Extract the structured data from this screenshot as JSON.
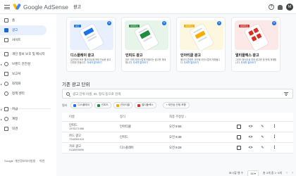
{
  "app": {
    "logo_text": "Google AdSense",
    "page_title": "광고",
    "avatar_letter": "M"
  },
  "top_actions": {
    "help": "?"
  },
  "sidebar": {
    "items": [
      {
        "label": "홈",
        "icon": "home-icon"
      },
      {
        "label": "광고",
        "icon": "ads-icon",
        "active": true
      },
      {
        "label": "사이트",
        "icon": "sites-icon"
      },
      {
        "label": "개인 정보 보호 및 메시지",
        "icon": "privacy-icon"
      },
      {
        "label": "브랜드 안전성",
        "icon": "brand-safety-icon"
      },
      {
        "label": "보고서",
        "icon": "reports-icon"
      },
      {
        "label": "최적화",
        "icon": "optimization-icon"
      },
      {
        "label": "정책 센터",
        "icon": "policy-icon"
      },
      {
        "label": "지급",
        "icon": "payments-icon"
      },
      {
        "label": "계정",
        "icon": "account-icon"
      },
      {
        "label": "의견",
        "icon": "feedback-icon"
      }
    ],
    "footer": {
      "brand": "Google",
      "link": "개인정보처리방침",
      "separator": "·",
      "terms": "약관"
    }
  },
  "cards": [
    {
      "tag": "광고",
      "title": "디스플레이 광고",
      "desc": "유연하게 모든 웹사이트에 게재 가능한 광고 단위를 만듭니다.",
      "link": "자세히 알아보기",
      "bg": "#e8f0fe",
      "accent": "#1a73e8"
    },
    {
      "tag": "네이티브",
      "title": "인피드 광고",
      "desc": "피드 안에 자연스럽게 어울리는 광고를 게재합니다.",
      "link": "자세히 알아보기",
      "bg": "#e6f4ea",
      "accent": "#1e8e3e"
    },
    {
      "tag": "네이티브",
      "title": "인아티클 광고",
      "desc": "페이지 콘텐츠 사이에 자연스럽게 게재됩니다.",
      "link": "자세히 알아보기",
      "bg": "#fef7e0",
      "accent": "#f9ab00"
    },
    {
      "tag": "네이티브",
      "title": "멀티플렉스 광고",
      "desc": "그리드 형식으로 여러 광고를 한 번에 게재합니다.",
      "link": "자세히 알아보기",
      "bg": "#fce8e6",
      "accent": "#d93025"
    }
  ],
  "section": {
    "title": "기존 광고 단위"
  },
  "search": {
    "placeholder": "광고 단위 이름, ID, 형식 등으로 검색"
  },
  "filters": {
    "label": "필터",
    "chips": [
      {
        "label": "디스플레이",
        "color": "#1a73e8"
      },
      {
        "label": "인피드",
        "color": "#1e8e3e"
      },
      {
        "label": "인아티클",
        "color": "#f9ab00"
      },
      {
        "label": "멀티플렉스",
        "color": "#d93025"
      }
    ],
    "add_label": "+ 보관된 단위 포함"
  },
  "table": {
    "headers": {
      "name": "이름",
      "type": "형식",
      "modified": "최종 수정일"
    },
    "rows": [
      {
        "name": "인피드",
        "id": "1976271986",
        "type": "인아티클",
        "modified": "오전 9:56"
      },
      {
        "name": "카드 광고",
        "id": "7248951015",
        "type": "인피드",
        "modified": "오전 9:38"
      },
      {
        "name": "가로 광고",
        "id": "9118409896",
        "type": "디스플레이",
        "modified": "오전 9:28"
      }
    ]
  },
  "pager": {
    "rows_label": "표시할 행 수",
    "rows_value": "30 ▾",
    "range": "총 3개 중 1~3개",
    "prev": "‹",
    "next": "›"
  }
}
